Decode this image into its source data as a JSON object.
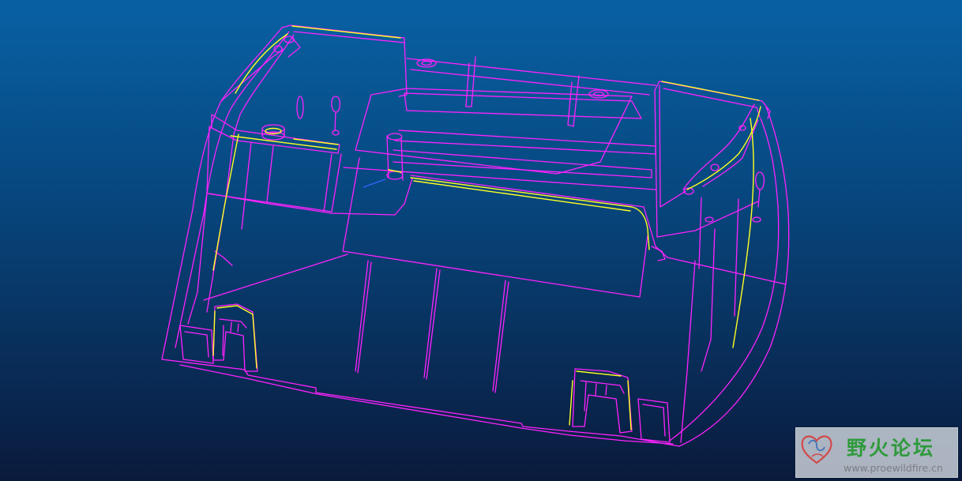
{
  "viewport": {
    "colors": {
      "background_top": "#0861a4",
      "background_bottom": "#0a1a3c",
      "edge": "#ff22ff",
      "highlight": "#ffff22",
      "axis": "#2f66ff"
    }
  },
  "watermark": {
    "title": "野火论坛",
    "url": "www.proewildfire.cn",
    "logo_icon": "heart-swirl-icon",
    "title_color": "#2f9a3c"
  }
}
